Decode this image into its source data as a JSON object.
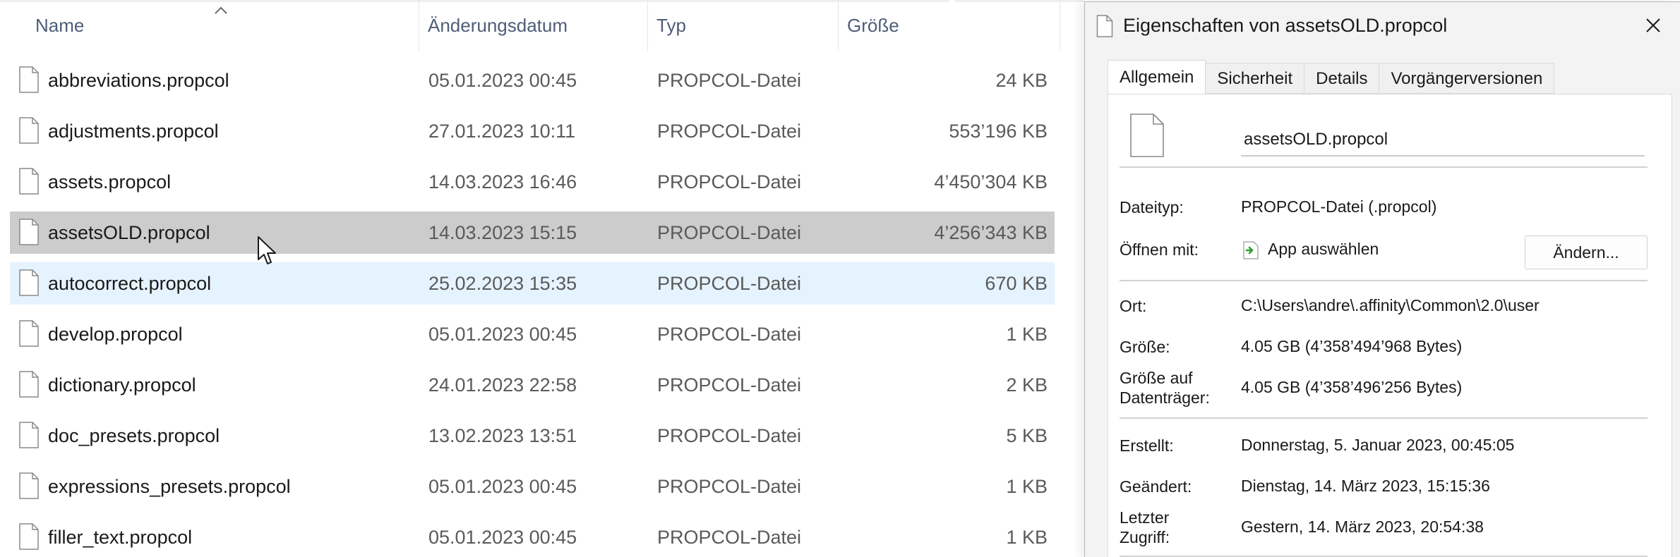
{
  "explorer": {
    "columns": {
      "name": "Name",
      "date": "Änderungsdatum",
      "type": "Typ",
      "size": "Größe"
    },
    "sort_icon": "chevron-up-icon",
    "rows": [
      {
        "name": "abbreviations.propcol",
        "date": "05.01.2023 00:45",
        "type": "PROPCOL-Datei",
        "size": "24 KB"
      },
      {
        "name": "adjustments.propcol",
        "date": "27.01.2023 10:11",
        "type": "PROPCOL-Datei",
        "size": "553’196 KB"
      },
      {
        "name": "assets.propcol",
        "date": "14.03.2023 16:46",
        "type": "PROPCOL-Datei",
        "size": "4’450’304 KB"
      },
      {
        "name": "assetsOLD.propcol",
        "date": "14.03.2023 15:15",
        "type": "PROPCOL-Datei",
        "size": "4’256’343 KB",
        "state": "selected"
      },
      {
        "name": "autocorrect.propcol",
        "date": "25.02.2023 15:35",
        "type": "PROPCOL-Datei",
        "size": "670 KB",
        "state": "hover"
      },
      {
        "name": "develop.propcol",
        "date": "05.01.2023 00:45",
        "type": "PROPCOL-Datei",
        "size": "1 KB"
      },
      {
        "name": "dictionary.propcol",
        "date": "24.01.2023 22:58",
        "type": "PROPCOL-Datei",
        "size": "2 KB"
      },
      {
        "name": "doc_presets.propcol",
        "date": "13.02.2023 13:51",
        "type": "PROPCOL-Datei",
        "size": "5 KB"
      },
      {
        "name": "expressions_presets.propcol",
        "date": "05.01.2023 00:45",
        "type": "PROPCOL-Datei",
        "size": "1 KB"
      },
      {
        "name": "filler_text.propcol",
        "date": "05.01.2023 00:45",
        "type": "PROPCOL-Datei",
        "size": "1 KB"
      }
    ],
    "colors": {
      "selected_row": "#cccccc",
      "hover_row": "#e5f3ff",
      "header_text": "#4e5d78"
    }
  },
  "dialog": {
    "title": "Eigenschaften von assetsOLD.propcol",
    "tabs": [
      {
        "label": "Allgemein",
        "active": true
      },
      {
        "label": "Sicherheit",
        "active": false
      },
      {
        "label": "Details",
        "active": false
      },
      {
        "label": "Vorgängerversionen",
        "active": false
      }
    ],
    "filename": "assetsOLD.propcol",
    "fields": {
      "type_label": "Dateityp:",
      "type_value": "PROPCOL-Datei (.propcol)",
      "open_label": "Öffnen mit:",
      "open_value": "App auswählen",
      "change_button": "Ändern...",
      "location_label": "Ort:",
      "location_value": "C:\\Users\\andre\\.affinity\\Common\\2.0\\user",
      "size_label": "Größe:",
      "size_value": "4.05 GB (4’358’494’968 Bytes)",
      "disk_size_label_1": "Größe auf",
      "disk_size_label_2": "Datenträger:",
      "disk_size_value": "4.05 GB (4’358’496’256 Bytes)",
      "created_label": "Erstellt:",
      "created_value": "Donnerstag, 5. Januar 2023, 00:45:05",
      "modified_label": "Geändert:",
      "modified_value": "Dienstag, 14. März 2023, 15:15:36",
      "accessed_label_1": "Letzter",
      "accessed_label_2": "Zugriff:",
      "accessed_value": "Gestern, 14. März 2023, 20:54:38"
    },
    "icons": {
      "title": "file-icon",
      "close": "close-icon",
      "big_file": "file-icon",
      "open_with": "app-select-arrow-icon"
    }
  }
}
